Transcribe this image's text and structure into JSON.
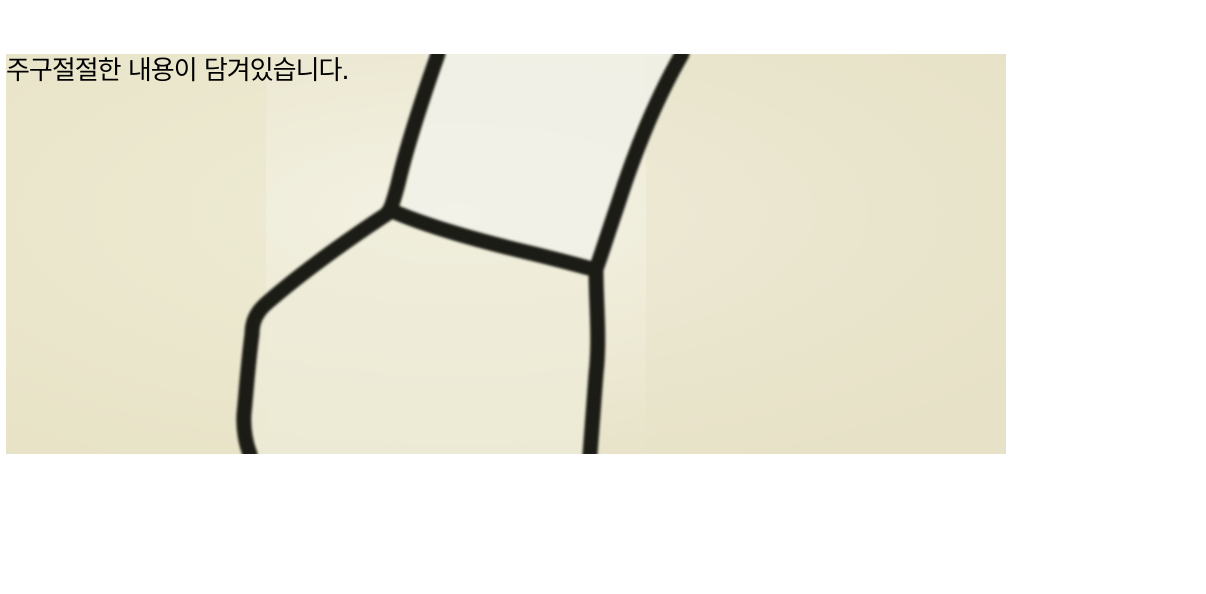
{
  "caption": {
    "text": "주구절절한 내용이 담겨있습니다."
  },
  "image": {
    "description_icon": "scanned-line-drawing",
    "colors": {
      "paper": "#ebe7cf",
      "paper_light": "#f3f1e2",
      "ink": "#1e1f18"
    }
  }
}
